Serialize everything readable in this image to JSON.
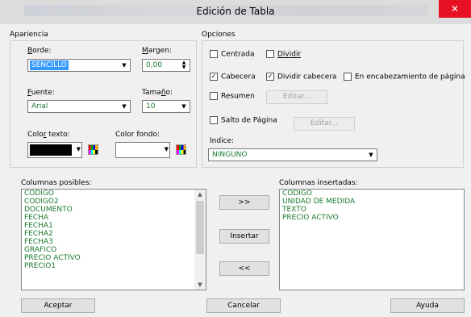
{
  "window": {
    "title": "Edición de Tabla",
    "close": "✕"
  },
  "appearance": {
    "heading": "Apariencia",
    "border_label": "Borde:",
    "border_value": "SENCILLO",
    "margin_label": "Margen:",
    "margin_value": "0,00",
    "font_label": "Fuente:",
    "font_value": "Arial",
    "size_label": "Tamaño:",
    "size_value": "10",
    "text_color_label": "Color texto:",
    "text_color": "#000000",
    "bg_color_label": "Color fondo:",
    "bg_color": "#ffffff"
  },
  "options": {
    "heading": "Opciones",
    "centered": "Centrada",
    "split": "Dividir",
    "header": "Cabecera",
    "split_header": "Dividir cabecera",
    "page_header": "En encabezamiento de página",
    "summary": "Resumen",
    "page_break": "Salto de Página",
    "edit1": "Editar...",
    "edit2": "Editar...",
    "index_label": "Indice:",
    "index_value": "NINGUNO"
  },
  "columns": {
    "possible_label": "Columnas posibles:",
    "possible": [
      "CODIGO",
      "CODIGO2",
      "DOCUMENTO",
      "FECHA",
      "FECHA1",
      "FECHA2",
      "FECHA3",
      "GRAFICO",
      "PRECIO ACTIVO",
      "PRECIO1"
    ],
    "inserted_label": "Columnas insertadas:",
    "inserted": [
      "CODIGO",
      "UNIDAD DE MEDIDA",
      "TEXTO",
      "PRECIO ACTIVO"
    ],
    "add_all": ">>",
    "insert": "Insertar",
    "remove_all": "<<"
  },
  "footer": {
    "accept": "Aceptar",
    "cancel": "Cancelar",
    "help": "Ayuda"
  }
}
